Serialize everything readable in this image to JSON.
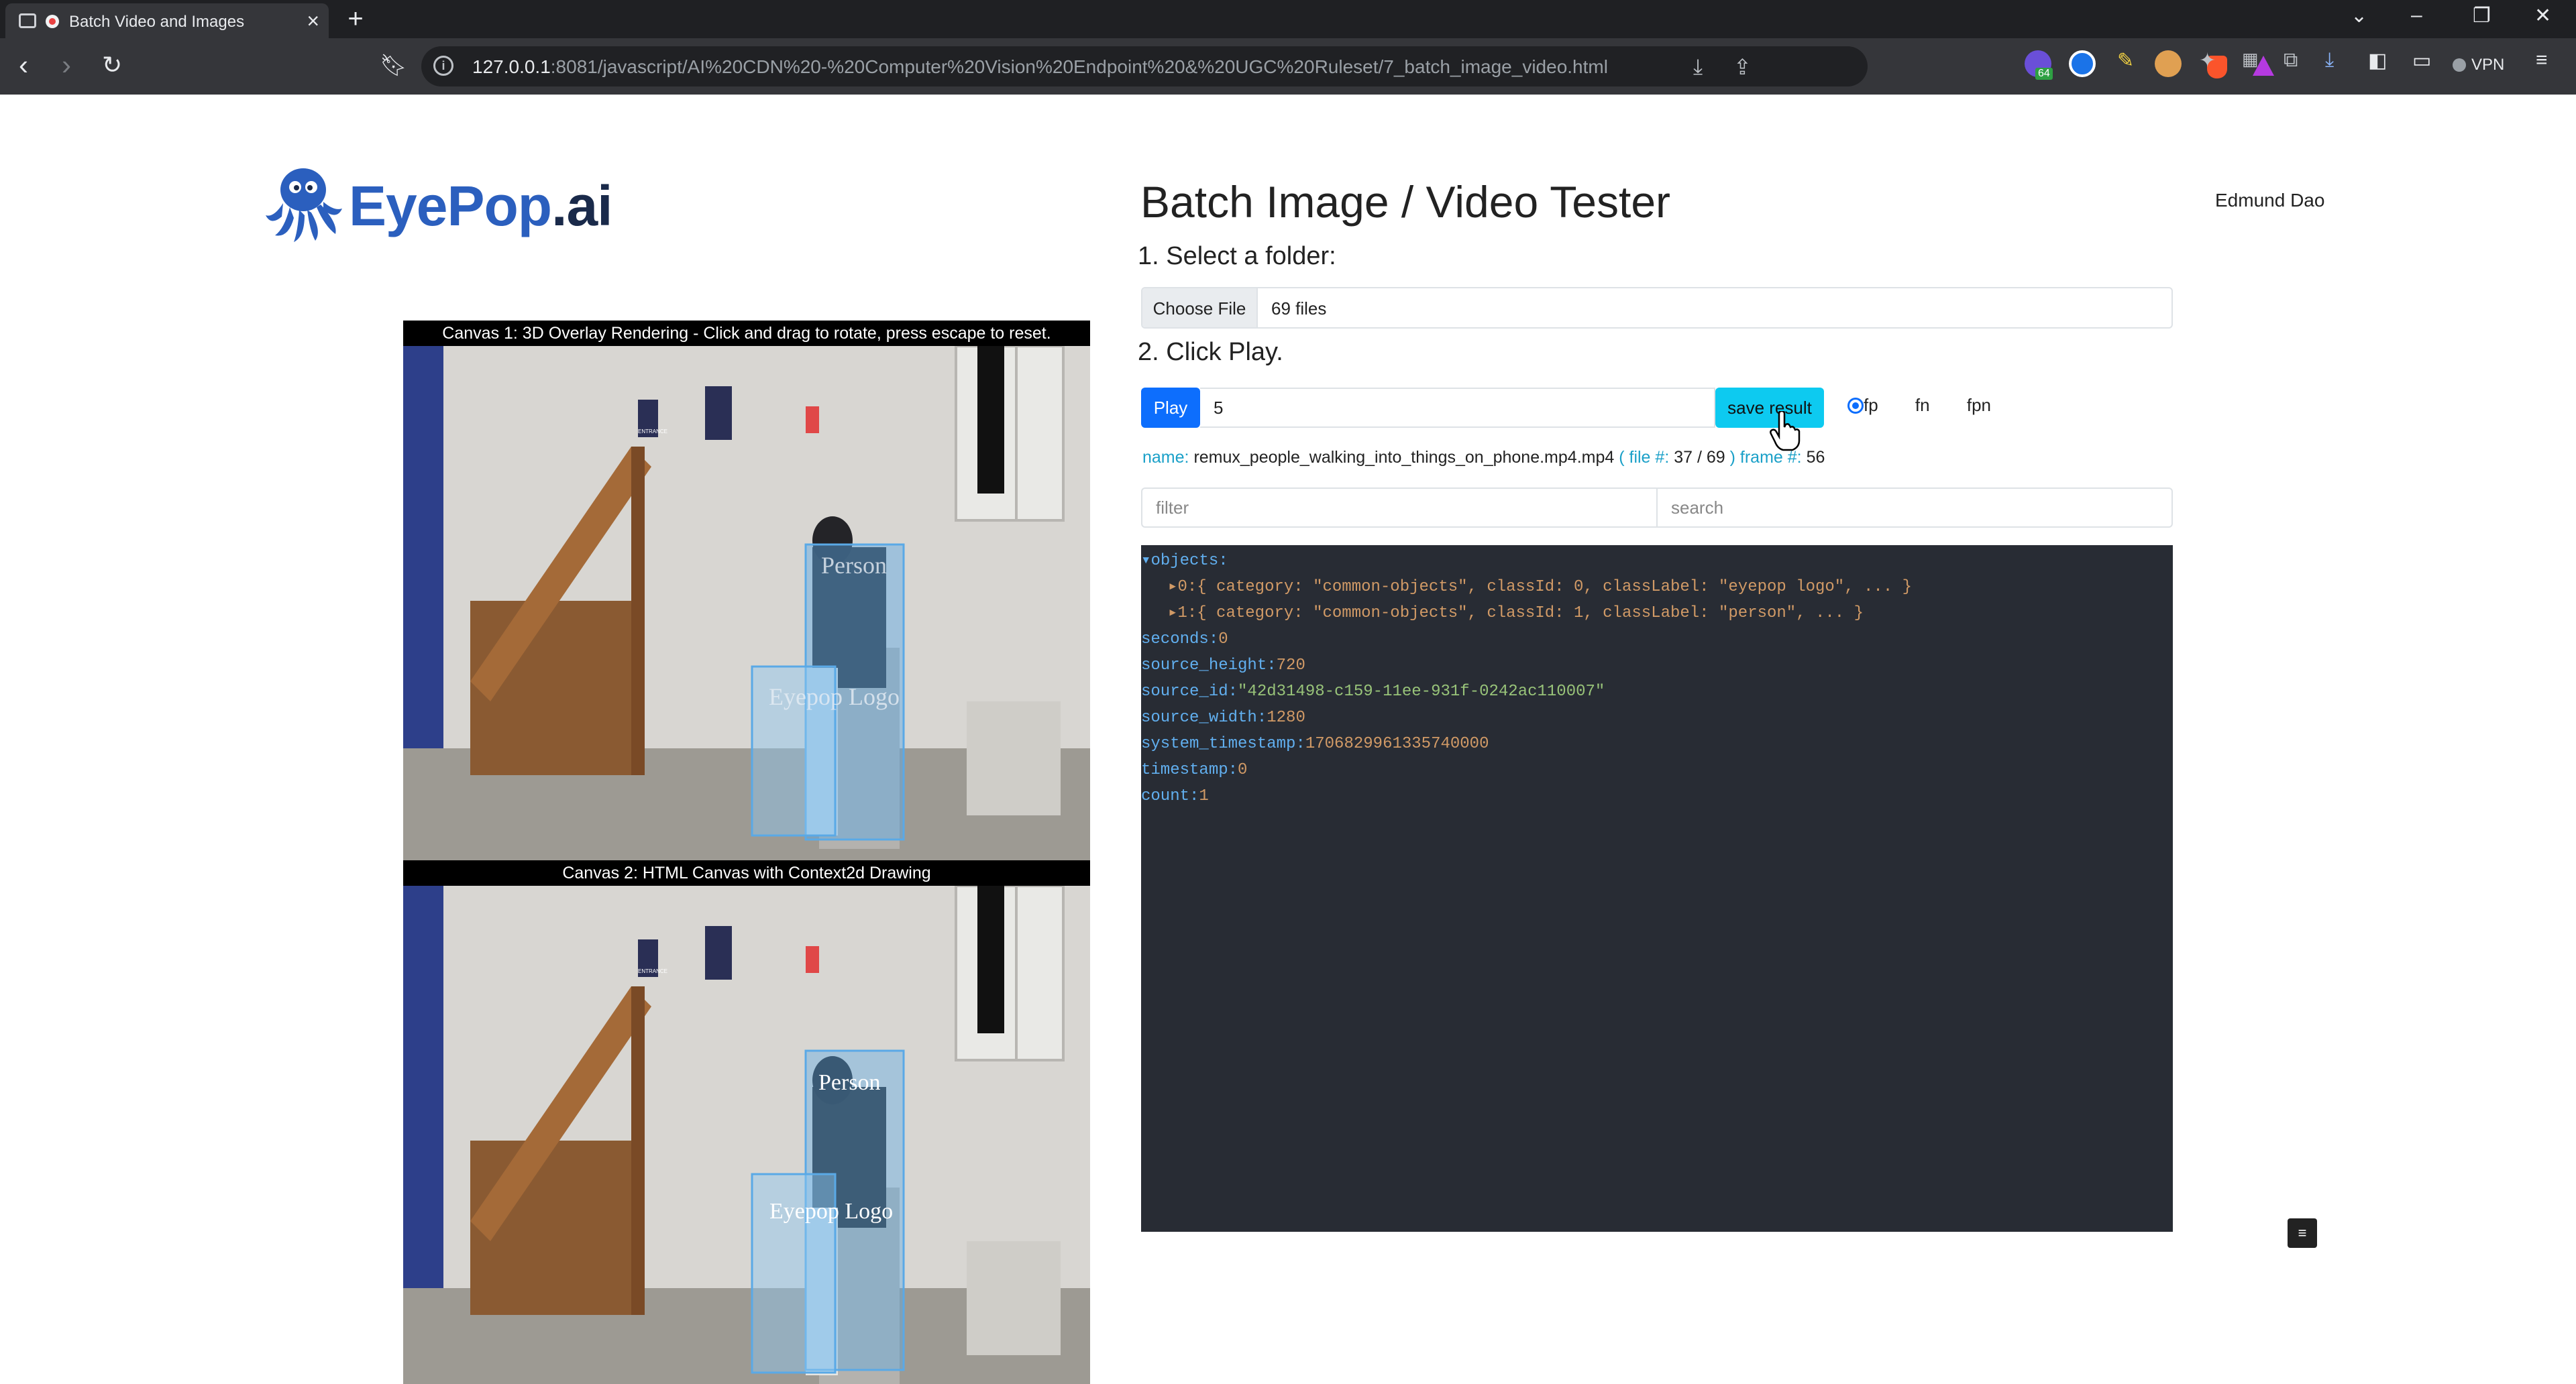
{
  "browser": {
    "tab_title": "Batch Video and Images",
    "url_host": "127.0.0.1",
    "url_rest": ":8081/javascript/AI%20CDN%20-%20Computer%20Vision%20Endpoint%20&%20UGC%20Ruleset/7_batch_image_video.html",
    "ext_badge": "64",
    "vpn_label": "VPN"
  },
  "logo": {
    "eye": "EyePop",
    "ai": ".ai"
  },
  "header": {
    "title": "Batch Image / Video Tester",
    "user": "Edmund Dao"
  },
  "step1": {
    "label": "1. Select a folder:",
    "choose_label": "Choose File",
    "file_count": "69 files"
  },
  "step2": {
    "label": "2. Click Play.",
    "play_label": "Play",
    "frame_value": "5",
    "save_label": "save result",
    "radios": [
      {
        "label": "fp",
        "checked": true
      },
      {
        "label": "fn",
        "checked": false
      },
      {
        "label": "fpn",
        "checked": false
      }
    ]
  },
  "info": {
    "name_key": "name:",
    "name_value": "remux_people_walking_into_things_on_phone.mp4.mp4",
    "file_key": "( file #:",
    "file_value": "37 / 69",
    "frame_key": ") frame #:",
    "frame_value": "56"
  },
  "filters": {
    "filter_placeholder": "filter",
    "search_placeholder": "search"
  },
  "json_view": {
    "objects_key": "▾objects:",
    "obj0": "▸0:{ category: \"common-objects\", classId: 0, classLabel: \"eyepop logo\", ... }",
    "obj1": "▸1:{ category: \"common-objects\", classId: 1, classLabel: \"person\", ... }",
    "seconds_key": "seconds:",
    "seconds_val": "0",
    "source_height_key": "source_height:",
    "source_height_val": "720",
    "source_id_key": "source_id:",
    "source_id_val": "\"42d31498-c159-11ee-931f-0242ac110007\"",
    "source_width_key": "source_width:",
    "source_width_val": "1280",
    "system_timestamp_key": "system_timestamp:",
    "system_timestamp_val": "1706829961335740000",
    "timestamp_key": "timestamp:",
    "timestamp_val": "0",
    "count_key": "count:",
    "count_val": "1"
  },
  "canvas1": {
    "caption": "Canvas 1: 3D Overlay Rendering - Click and drag to rotate, press escape to reset."
  },
  "canvas2": {
    "caption": "Canvas 2: HTML Canvas with Context2d Drawing"
  },
  "detections": {
    "person_label": "Person",
    "logo_label": "Eyepop Logo"
  },
  "scene_signs": {
    "entrance": "ENTRANCE"
  },
  "colors": {
    "primary": "#0d6efd",
    "info": "#0dcaf0",
    "json_bg": "#282c34",
    "box": "#5aa9e6"
  }
}
